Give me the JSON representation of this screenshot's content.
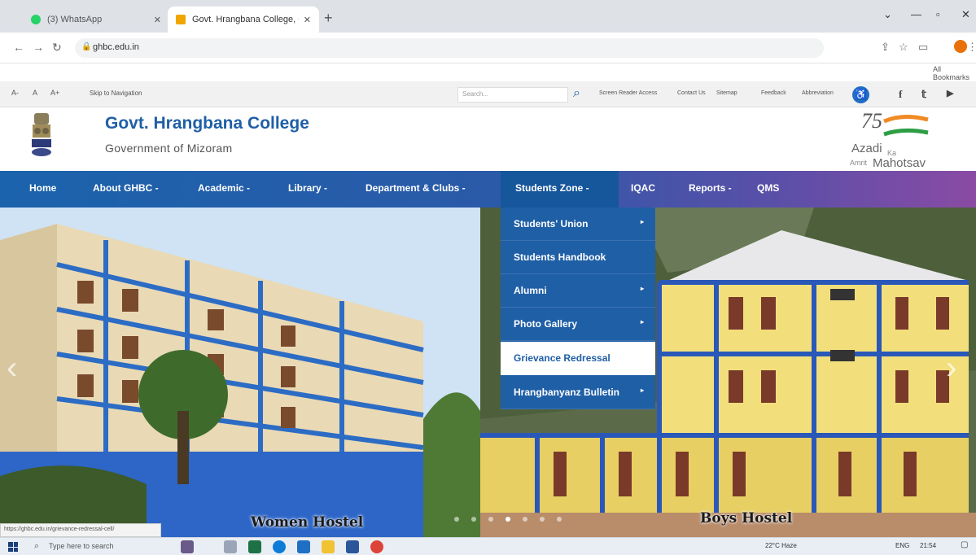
{
  "browser": {
    "tabs": [
      {
        "title": "(3) WhatsApp",
        "active": false
      },
      {
        "title": "Govt. Hrangbana College, Govt.",
        "active": true
      }
    ],
    "url": "ghbc.edu.in",
    "bookmarks_label": "All Bookmarks"
  },
  "utility_bar": {
    "font_sizes": [
      "A-",
      "A",
      "A+"
    ],
    "skip_link": "Skip to Navigation",
    "search_placeholder": "Search...",
    "links": [
      "Screen Reader Access",
      "Contact Us",
      "Sitemap",
      "Feedback",
      "Abbreviation"
    ],
    "social": [
      "f",
      "t",
      "yt"
    ]
  },
  "header": {
    "college_name": "Govt. Hrangbana College",
    "subtitle": "Government of Mizoram",
    "azadi_line1": "Azadi",
    "azadi_ka": "Ka",
    "azadi_line2": "Amrit",
    "azadi_line3": "Mahotsav",
    "azadi_num": "75"
  },
  "nav": {
    "items": [
      "Home",
      "About GHBC -",
      "Academic -",
      "Library -",
      "Department & Clubs -",
      "Students Zone -",
      "IQAC",
      "Reports -",
      "QMS"
    ]
  },
  "dropdown": {
    "items": [
      {
        "label": "Students' Union",
        "has_sub": true
      },
      {
        "label": "Students Handbook",
        "has_sub": false
      },
      {
        "label": "Alumni",
        "has_sub": true
      },
      {
        "label": "Photo Gallery",
        "has_sub": true
      },
      {
        "label": "Grievance Redressal",
        "has_sub": false,
        "highlighted": true
      },
      {
        "label": "Hrangbanyanz Bulletin",
        "has_sub": true
      }
    ]
  },
  "hero": {
    "caption_left": "Women Hostel",
    "caption_right": "Boys Hostel",
    "active_slide": 3,
    "slide_count": 7
  },
  "status_bar_link": "https://ghbc.edu.in/grievance-redressal-cell/",
  "taskbar": {
    "search_placeholder": "Type here to search",
    "weather": "22°C Haze",
    "lang": "ENG",
    "time": "21:54"
  }
}
